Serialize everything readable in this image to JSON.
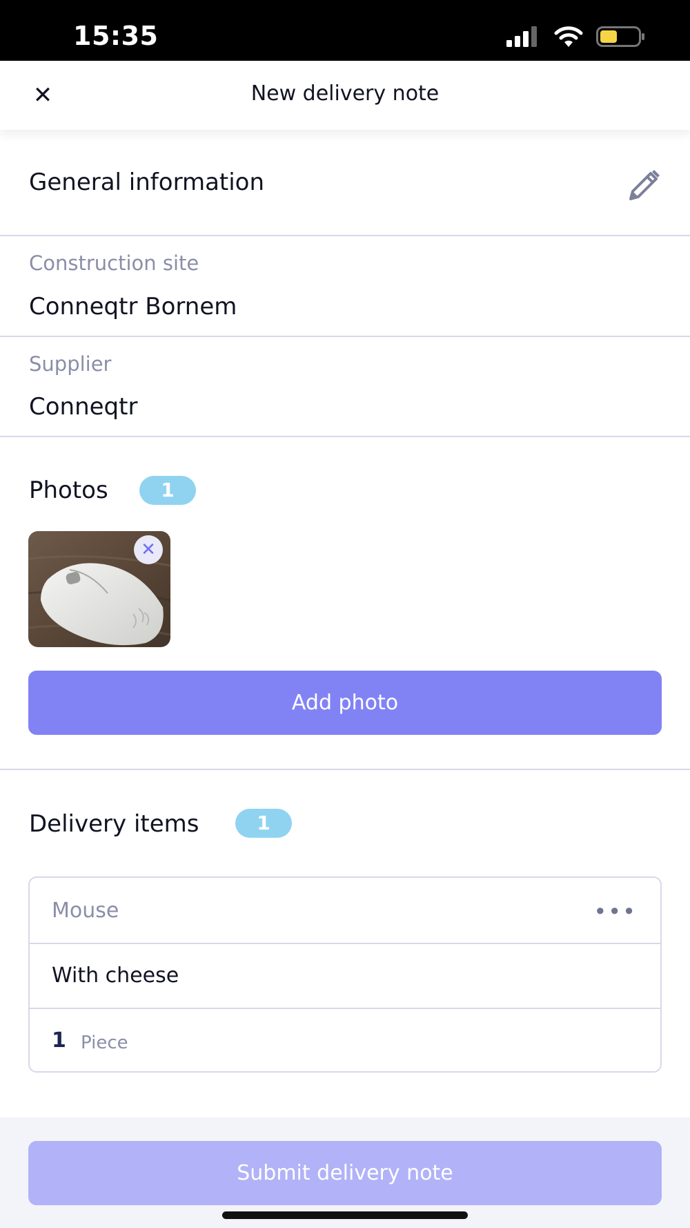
{
  "status_bar": {
    "time": "15:35"
  },
  "header": {
    "title": "New delivery note"
  },
  "general": {
    "title": "General information",
    "construction_site_label": "Construction site",
    "construction_site_value": "Conneqtr Bornem",
    "supplier_label": "Supplier",
    "supplier_value": "Conneqtr"
  },
  "photos": {
    "title": "Photos",
    "count": "1",
    "add_label": "Add photo"
  },
  "delivery_items": {
    "title": "Delivery items",
    "count": "1",
    "items": [
      {
        "name": "Mouse",
        "description": "With cheese",
        "quantity": "1",
        "unit": "Piece"
      }
    ]
  },
  "footer": {
    "submit_label": "Submit delivery note"
  },
  "colors": {
    "accent": "#8183f5",
    "accent_disabled": "#b1b2f7",
    "badge": "#8fd3f1",
    "divider": "#d6d9ec",
    "battery": "#f5d547"
  }
}
